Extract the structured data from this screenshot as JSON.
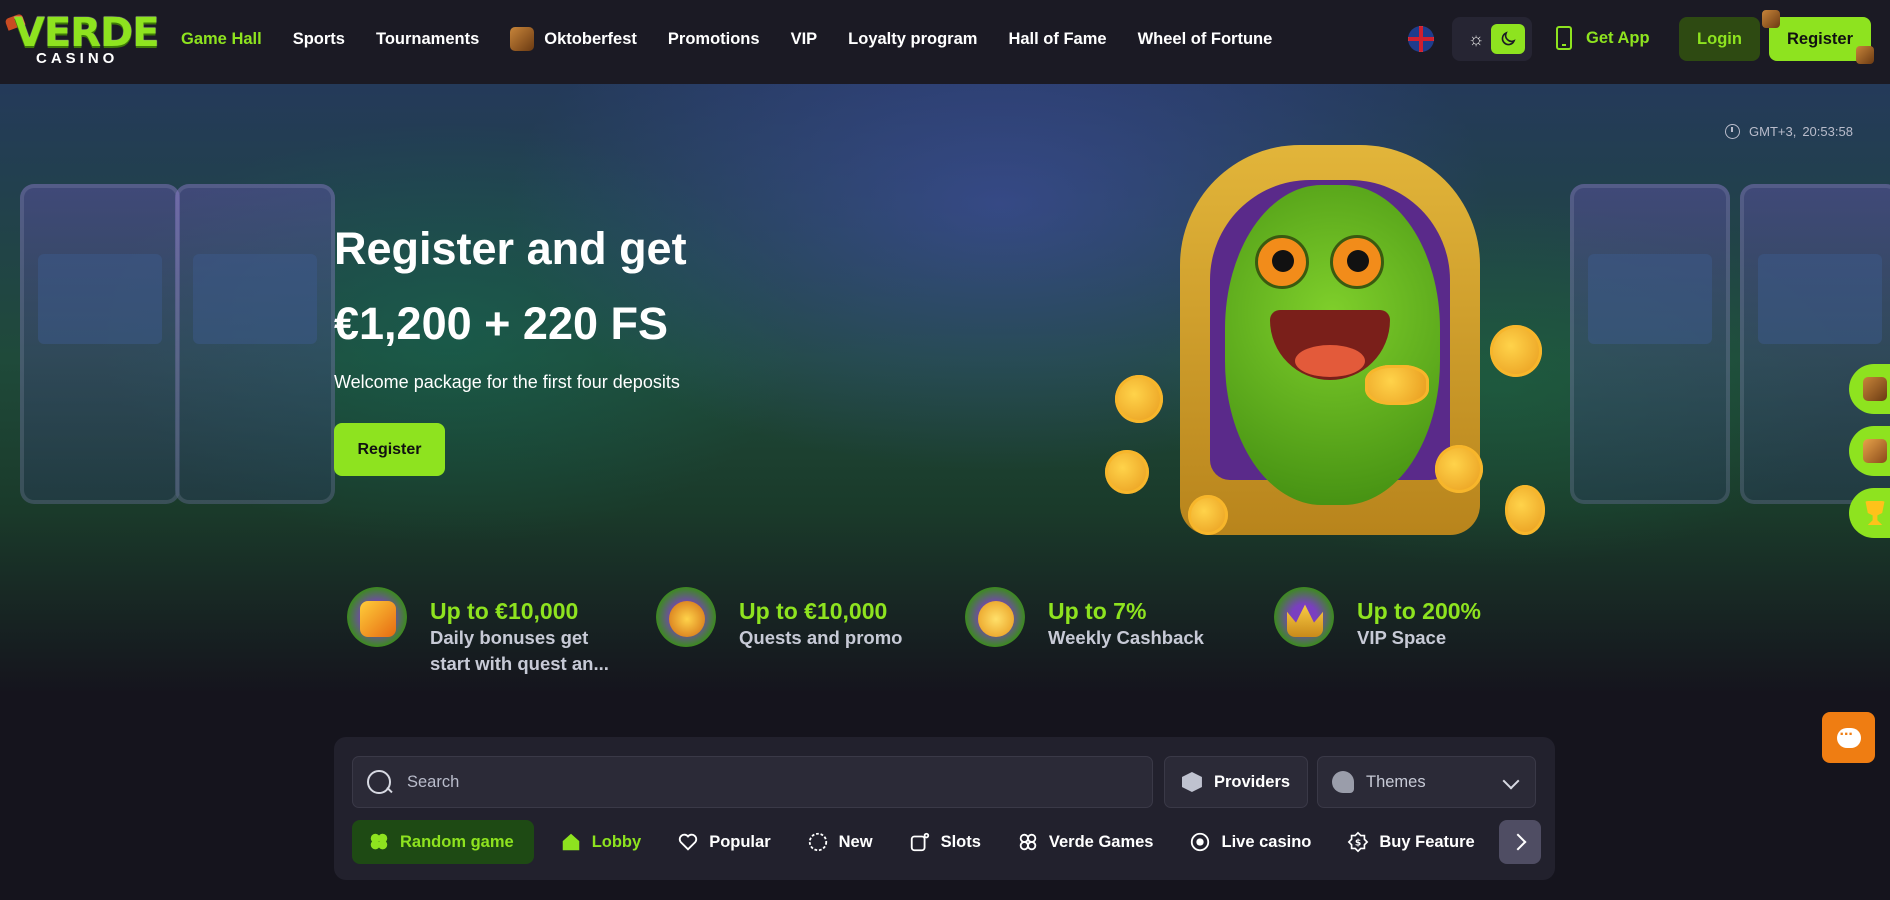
{
  "header": {
    "logo_text": "VERDE",
    "logo_sub": "CASINO",
    "nav": [
      {
        "label": "Game Hall",
        "active": true
      },
      {
        "label": "Sports"
      },
      {
        "label": "Tournaments"
      },
      {
        "label": "Oktoberfest",
        "icon": "oktoberfest-icon"
      },
      {
        "label": "Promotions"
      },
      {
        "label": "VIP"
      },
      {
        "label": "Loyalty program"
      },
      {
        "label": "Hall of Fame"
      },
      {
        "label": "Wheel of Fortune"
      }
    ],
    "language_icon": "uk-flag-icon",
    "theme_icons": [
      "sun-icon",
      "moon-icon"
    ],
    "get_app_label": "Get App",
    "login_label": "Login",
    "register_label": "Register"
  },
  "hero": {
    "time_zone": "GMT+3,",
    "time": "20:53:58",
    "title": "Register and get",
    "amount": "€1,200 + 220 FS",
    "subtitle": "Welcome package for the first four deposits",
    "register_label": "Register",
    "promos": [
      {
        "title": "Up to €10,000",
        "desc_line1": "Daily bonuses get",
        "desc_line2": "start with quest an...",
        "icon": "gift-icon"
      },
      {
        "title": "Up to €10,000",
        "desc_line1": "Quests and promo",
        "desc_line2": "",
        "icon": "compass-icon"
      },
      {
        "title": "Up to 7%",
        "desc_line1": "Weekly Cashback",
        "desc_line2": "",
        "icon": "coins-icon"
      },
      {
        "title": "Up to 200%",
        "desc_line1": "VIP Space",
        "desc_line2": "",
        "icon": "crown-icon"
      }
    ]
  },
  "side_tabs": [
    "bonus-chest-icon",
    "treasure-chest-icon",
    "trophy-icon"
  ],
  "chat_icon": "chat-icon",
  "games": {
    "search_placeholder": "Search",
    "providers_label": "Providers",
    "themes_label": "Themes",
    "categories": [
      {
        "label": "Random game",
        "icon": "clover-icon"
      },
      {
        "label": "Lobby",
        "icon": "home-icon"
      },
      {
        "label": "Popular",
        "icon": "heart-icon"
      },
      {
        "label": "New",
        "icon": "new-badge-icon"
      },
      {
        "label": "Slots",
        "icon": "slots-icon"
      },
      {
        "label": "Verde Games",
        "icon": "verde-games-icon"
      },
      {
        "label": "Live casino",
        "icon": "live-icon"
      },
      {
        "label": "Buy Feature",
        "icon": "dollar-icon"
      }
    ]
  },
  "colors": {
    "accent": "#8ee31f",
    "background": "#15141d",
    "header": "#1b1a24",
    "panel": "#22212d",
    "chat": "#ef7d12"
  }
}
